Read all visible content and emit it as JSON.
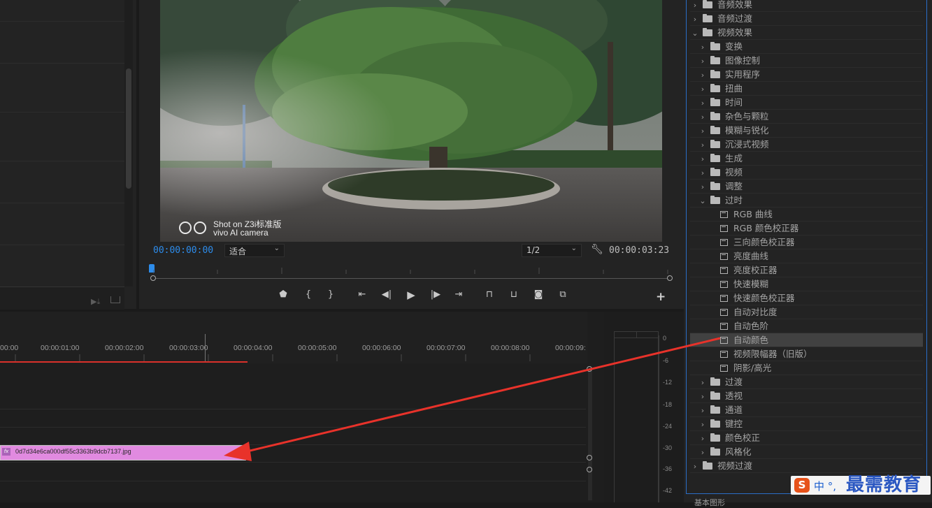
{
  "program_monitor": {
    "current_timecode": "00:00:00:00",
    "duration_timecode": "00:00:03:23",
    "fit_option": "适合",
    "resolution_option": "1/2",
    "video_watermark_line1": "Shot on Z3i标准版",
    "video_watermark_line2": "vivo AI camera",
    "transport_buttons": [
      "add-marker",
      "mark-in",
      "mark-out",
      "go-to-in",
      "step-back",
      "play",
      "step-forward",
      "go-to-out",
      "lift",
      "extract",
      "export-frame",
      "compare-view",
      "add-button"
    ]
  },
  "timeline": {
    "ruler_labels": [
      "00:00",
      "00:00:01:00",
      "00:00:02:00",
      "00:00:03:00",
      "00:00:04:00",
      "00:00:05:00",
      "00:00:06:00",
      "00:00:07:00",
      "00:00:08:00",
      "00:00:09:"
    ],
    "clip_label": "0d7d34e6ca000df55c3363b9dcb7137.jpg",
    "clip_fx": "fx"
  },
  "audio_meter": {
    "scale": [
      "0",
      "-6",
      "-12",
      "-18",
      "-24",
      "-30",
      "-36",
      "-42"
    ]
  },
  "effects_panel": {
    "items": [
      {
        "label": "音频效果",
        "level": 0,
        "type": "folder",
        "expanded": false
      },
      {
        "label": "音频过渡",
        "level": 0,
        "type": "folder",
        "expanded": false
      },
      {
        "label": "视频效果",
        "level": 0,
        "type": "folder",
        "expanded": true
      },
      {
        "label": "变换",
        "level": 1,
        "type": "folder",
        "expanded": false
      },
      {
        "label": "图像控制",
        "level": 1,
        "type": "folder",
        "expanded": false
      },
      {
        "label": "实用程序",
        "level": 1,
        "type": "folder",
        "expanded": false
      },
      {
        "label": "扭曲",
        "level": 1,
        "type": "folder",
        "expanded": false
      },
      {
        "label": "时间",
        "level": 1,
        "type": "folder",
        "expanded": false
      },
      {
        "label": "杂色与颗粒",
        "level": 1,
        "type": "folder",
        "expanded": false
      },
      {
        "label": "模糊与锐化",
        "level": 1,
        "type": "folder",
        "expanded": false
      },
      {
        "label": "沉浸式视频",
        "level": 1,
        "type": "folder",
        "expanded": false
      },
      {
        "label": "生成",
        "level": 1,
        "type": "folder",
        "expanded": false
      },
      {
        "label": "视频",
        "level": 1,
        "type": "folder",
        "expanded": false
      },
      {
        "label": "调整",
        "level": 1,
        "type": "folder",
        "expanded": false
      },
      {
        "label": "过时",
        "level": 1,
        "type": "folder",
        "expanded": true
      },
      {
        "label": "RGB 曲线",
        "level": 2,
        "type": "effect"
      },
      {
        "label": "RGB 颜色校正器",
        "level": 2,
        "type": "effect"
      },
      {
        "label": "三向颜色校正器",
        "level": 2,
        "type": "effect"
      },
      {
        "label": "亮度曲线",
        "level": 2,
        "type": "effect"
      },
      {
        "label": "亮度校正器",
        "level": 2,
        "type": "effect"
      },
      {
        "label": "快速模糊",
        "level": 2,
        "type": "effect"
      },
      {
        "label": "快速颜色校正器",
        "level": 2,
        "type": "effect"
      },
      {
        "label": "自动对比度",
        "level": 2,
        "type": "effect"
      },
      {
        "label": "自动色阶",
        "level": 2,
        "type": "effect"
      },
      {
        "label": "自动颜色",
        "level": 2,
        "type": "effect",
        "selected": true
      },
      {
        "label": "视频限幅器（旧版）",
        "level": 2,
        "type": "effect"
      },
      {
        "label": "阴影/高光",
        "level": 2,
        "type": "effect"
      },
      {
        "label": "过渡",
        "level": 1,
        "type": "folder",
        "expanded": false
      },
      {
        "label": "透视",
        "level": 1,
        "type": "folder",
        "expanded": false
      },
      {
        "label": "通道",
        "level": 1,
        "type": "folder",
        "expanded": false
      },
      {
        "label": "键控",
        "level": 1,
        "type": "folder",
        "expanded": false
      },
      {
        "label": "颜色校正",
        "level": 1,
        "type": "folder",
        "expanded": false
      },
      {
        "label": "风格化",
        "level": 1,
        "type": "folder",
        "expanded": false
      },
      {
        "label": "视频过渡",
        "level": 0,
        "type": "folder",
        "expanded": false
      }
    ],
    "bottom_panel_label": "基本图形"
  },
  "ime": {
    "logo": "S",
    "text": "中 °, ",
    "watermark": "最需教育"
  },
  "colors": {
    "accent_blue": "#2d8ceb",
    "clip_pink": "#e18ae0",
    "arrow_red": "#e8322a",
    "work_area_red": "#d9302a"
  }
}
